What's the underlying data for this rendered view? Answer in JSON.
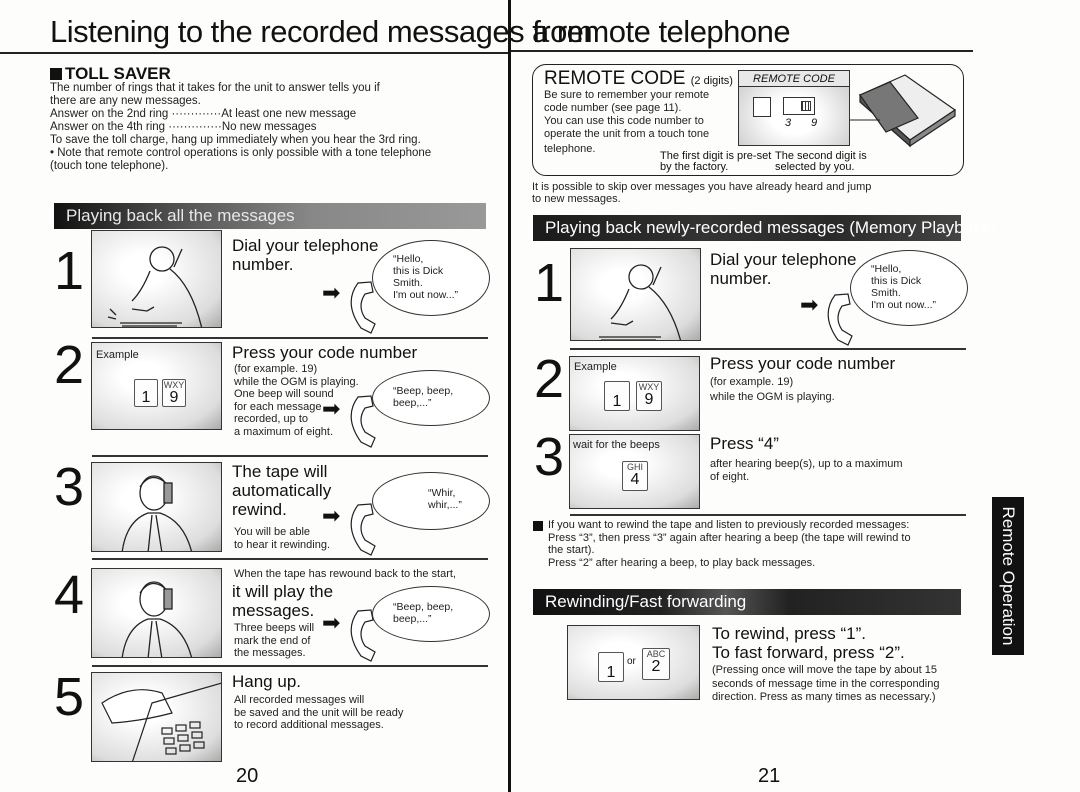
{
  "header": {
    "title_left": "Listening to the recorded messages from",
    "title_right": "a remote telephone"
  },
  "toll_saver": {
    "heading": "TOLL SAVER",
    "lines": [
      "The number of rings that it takes for the unit to answer tells you if",
      "there are any new messages.",
      "Answer on the 2nd ring ·············At least one new message",
      "Answer on the 4th ring ··············No new messages",
      "To save the toll charge, hang up immediately when you hear the 3rd ring.",
      "• Note that remote control operations is only possible with a tone telephone",
      "(touch tone telephone)."
    ]
  },
  "left_section": {
    "banner": "Playing back all the messages",
    "steps": [
      {
        "num": "1",
        "heading": [
          "Dial your telephone",
          "number."
        ],
        "body": [],
        "bubble": [
          "“Hello,",
          "this is Dick",
          "Smith.",
          "I'm out now...”"
        ]
      },
      {
        "num": "2",
        "box_label": "Example",
        "keys": [
          {
            "digit": "1",
            "letters": ""
          },
          {
            "digit": "9",
            "letters": "WXY"
          }
        ],
        "heading": [
          "Press your code number"
        ],
        "body": [
          "(for example. 19)",
          " while the OGM is playing.",
          " One beep will sound",
          "  for each message",
          " recorded, up to",
          " a maximum of eight."
        ],
        "bubble": [
          "“Beep, beep,",
          "beep,...”"
        ]
      },
      {
        "num": "3",
        "heading": [
          "The tape will",
          "automatically",
          "rewind."
        ],
        "body": [
          "You will be able",
          " to hear it rewinding."
        ],
        "bubble": [
          "“Whir,",
          "whir,...”"
        ]
      },
      {
        "num": "4",
        "pre": "When the tape has rewound back to the start,",
        "heading": [
          "it will play the",
          "messages."
        ],
        "body": [
          "Three beeps will",
          "mark the end of",
          "the messages."
        ],
        "bubble": [
          "“Beep, beep,",
          "beep,...”"
        ]
      },
      {
        "num": "5",
        "heading": [
          "Hang up."
        ],
        "body": [
          "All recorded messages will",
          "be saved and the unit will be ready",
          "to record additional messages."
        ]
      }
    ],
    "page_number": "20"
  },
  "remote_code": {
    "heading": "REMOTE CODE",
    "heading_note": "(2 digits)",
    "lines": [
      "Be sure to remember  your remote",
      "code number (see page 11).",
      "You can use this code number to",
      "operate the unit from a touch tone",
      "telephone."
    ],
    "panel_label": "REMOTE CODE",
    "digit_first": "3",
    "digit_second": "9",
    "caption_first": [
      "The first digit is pre-set",
      "by the factory."
    ],
    "caption_second": [
      "The second digit is",
      "selected by you."
    ]
  },
  "right_section": {
    "intro": [
      "It is possible to skip over messages you have already heard and jump",
      "to new messages."
    ],
    "banner": "Playing back newly-recorded messages (Memory Playback)",
    "steps": [
      {
        "num": "1",
        "heading": [
          "Dial your telephone",
          "number."
        ],
        "bubble": [
          "“Hello,",
          "this is Dick",
          "Smith.",
          "I'm out now...”"
        ]
      },
      {
        "num": "2",
        "box_label": "Example",
        "keys": [
          {
            "digit": "1",
            "letters": ""
          },
          {
            "digit": "9",
            "letters": "WXY"
          }
        ],
        "heading": [
          "Press your code number"
        ],
        "body": [
          "(for example. 19)",
          "while the OGM is playing."
        ]
      },
      {
        "num": "3",
        "box_label": "wait for the beeps",
        "keys": [
          {
            "digit": "4",
            "letters": "GHI"
          }
        ],
        "heading": [
          "Press “4”"
        ],
        "body": [
          "after hearing beep(s), up to a maximum",
          "of eight."
        ]
      }
    ],
    "rewind_note": [
      "If you want to rewind the tape and listen to previously recorded messages:",
      "Press “3”, then press “3” again after hearing a beep (the tape will rewind to",
      "the start).",
      "Press “2” after hearing a beep, to play back messages."
    ],
    "banner2": "Rewinding/Fast forwarding",
    "ff": {
      "keys": [
        {
          "digit": "1",
          "letters": ""
        },
        {
          "digit": "2",
          "letters": "ABC"
        }
      ],
      "or_label": "or",
      "heading": [
        "To rewind, press “1”.",
        "To fast forward, press “2”."
      ],
      "body": [
        "(Pressing once will move the tape by about 15",
        " seconds of message time in the corresponding",
        " direction. Press as many times as necessary.)"
      ]
    },
    "page_number": "21"
  },
  "side_tab": "Remote Operation"
}
